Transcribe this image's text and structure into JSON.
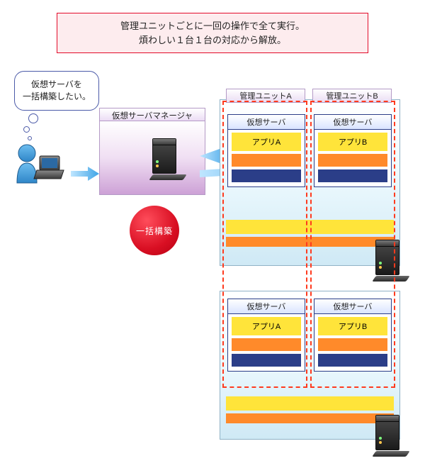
{
  "banner": {
    "line1": "管理ユニットごとに一回の操作で全て実行。",
    "line2": "煩わしい１台１台の対応から解放。"
  },
  "thought": {
    "line1": "仮想サーバを",
    "line2": "一括構築したい。"
  },
  "manager": {
    "title": "仮想サーバマネージャ"
  },
  "action_badge": "一括構築",
  "units": {
    "a_label": "管理ユニットA",
    "b_label": "管理ユニットB"
  },
  "vserver_label": "仮想サーバ",
  "apps": {
    "a": "アプリA",
    "b": "アプリB"
  },
  "icons": {
    "user": "user-with-laptop-icon",
    "server": "server-rack-icon",
    "arrow_right": "arrow-right-icon",
    "deploy_arrow": "deploy-arrow-icon"
  },
  "colors": {
    "accent_red": "#e30b2a",
    "accent_orange": "#ff8a2a",
    "accent_yellow": "#ffe43a",
    "accent_navy": "#2b3e88",
    "accent_blue": "#3fa4e6"
  }
}
